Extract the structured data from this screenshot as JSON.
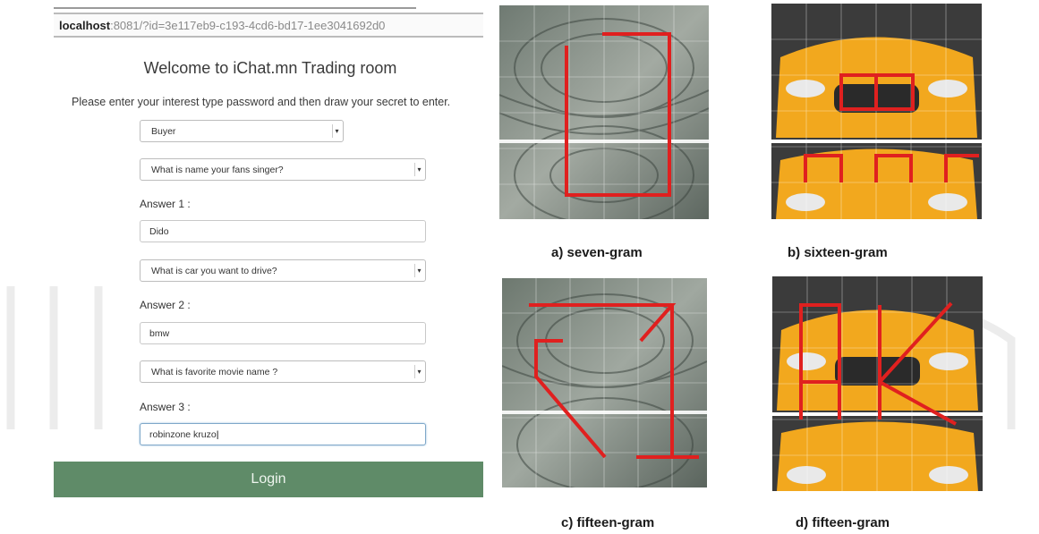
{
  "browser": {
    "url_host": "localhost",
    "url_rest": ":8081/?id=3e117eb9-c193-4cd6-bd17-1ee3041692d0"
  },
  "form": {
    "welcome": "Welcome to iChat.mn Trading room",
    "instructions": "Please enter your interest type password and then draw your secret to enter.",
    "interest_type": "Buyer",
    "question1": "What is name your fans singer?",
    "answer1_label": "Answer 1 :",
    "answer1_value": "Dido",
    "question2": "What is car you want to drive?",
    "answer2_label": "Answer 2 :",
    "answer2_value": "bmw",
    "question3": "What is favorite movie name ?",
    "answer3_label": "Answer 3 :",
    "answer3_value": "robinzone kruzo",
    "login_label": "Login"
  },
  "figures": [
    {
      "caption": "a) seven-gram",
      "scene": "city",
      "pattern_color": "#e0201f"
    },
    {
      "caption": "b) sixteen-gram",
      "scene": "car",
      "pattern_color": "#e0201f"
    },
    {
      "caption": "c) fifteen-gram",
      "scene": "city",
      "pattern_color": "#e0201f"
    },
    {
      "caption": "d) fifteen-gram",
      "scene": "car",
      "pattern_color": "#e0201f"
    }
  ],
  "colors": {
    "login_button": "#5f8b68",
    "pattern_line": "#e0201f",
    "car_body": "#f2a81e"
  }
}
